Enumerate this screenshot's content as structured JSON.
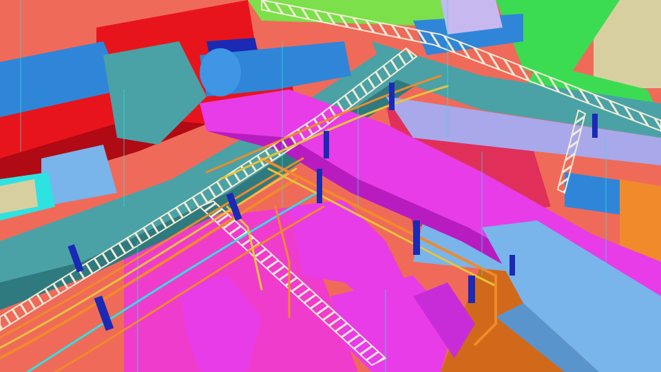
{
  "scene": {
    "description_visible_text": "",
    "colors": {
      "background_salmon": "#f06a5a",
      "background_pink": "#f03ccc",
      "red_duct": "#e8141c",
      "teal_duct": "#4aa2a6",
      "magenta_duct": "#e83ce8",
      "light_blue_duct": "#79b4ea",
      "blue_duct": "#2f86d8",
      "green_duct": "#3cdc52",
      "lavender_duct": "#a8a8ea",
      "navy_support": "#1a2ab4",
      "cable_tray": "#f2ecd6",
      "orange_pipe": "#f08a2a",
      "yellow_pipe": "#e8c43a",
      "cyan_pipe": "#2ee2e2",
      "beige_wall": "#d8cfa0",
      "dark_orange": "#d06a1a"
    }
  }
}
